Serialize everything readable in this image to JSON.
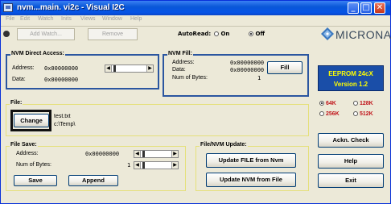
{
  "window": {
    "title": "nvm...main. vi2c - Visual I2C",
    "minimize": "_",
    "maximize": "□",
    "close": "✕"
  },
  "menu": {
    "items": [
      "File",
      "Edit",
      "Watch",
      "Inits",
      "Views",
      "Window",
      "Help"
    ]
  },
  "toolbar": {
    "add_watch": "Add Watch...",
    "remove": "Remove",
    "autoread_label": "AutoRead:",
    "on_label": "On",
    "off_label": "Off",
    "autoread_selected": "Off",
    "logo_text": "MICRONAS",
    "logo_color": "#3a4a5c"
  },
  "nvm_direct": {
    "title": "NVM Direct Access:",
    "address_label": "Address:",
    "address_value": "0x00000000",
    "data_label": "Data:",
    "data_value": "0x00000000"
  },
  "nvm_fill": {
    "title": "NVM Fill:",
    "address_label": "Address:",
    "address_value": "0x00000000",
    "data_label": "Data:",
    "data_value": "0x00000000",
    "bytes_label": "Num of Bytes:",
    "bytes_value": "1",
    "fill_button": "Fill"
  },
  "file": {
    "title": "File:",
    "change_button": "Change",
    "filename": "test.txt",
    "path": "c:\\Temp\\"
  },
  "eeprom": {
    "line1": "EEPROM 24cX",
    "line2": "Version 1.2",
    "bg_color": "#1a4ea8",
    "text_color": "#ffff00"
  },
  "sizes": {
    "options": [
      "64K",
      "128K",
      "256K",
      "512K"
    ],
    "selected": "64K",
    "color": "#c0141a"
  },
  "file_save": {
    "title": "File Save:",
    "address_label": "Address:",
    "address_value": "0x00000000",
    "bytes_label": "Num of Bytes:",
    "bytes_value": "1",
    "save_button": "Save",
    "append_button": "Append"
  },
  "file_nvm_update": {
    "title": "File/NVM Update:",
    "update_file_button": "Update FILE from Nvm",
    "update_nvm_button": "Update NVM from File"
  },
  "right_buttons": {
    "ackn_check": "Ackn. Check",
    "help": "Help",
    "exit": "Exit"
  }
}
